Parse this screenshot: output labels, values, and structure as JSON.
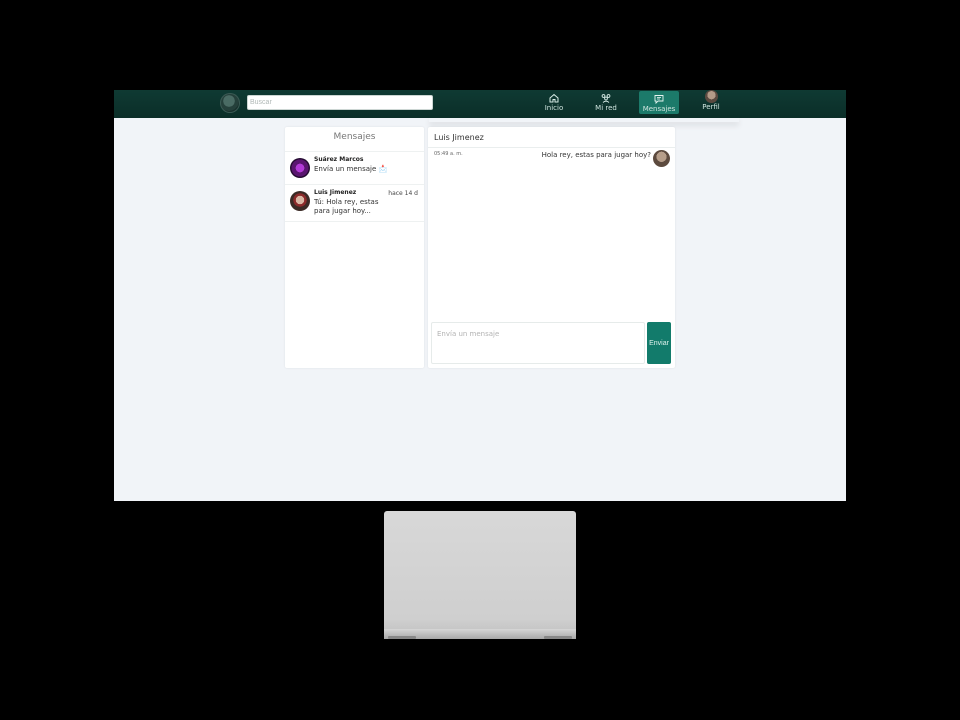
{
  "navbar": {
    "search_placeholder": "Buscar",
    "items": [
      {
        "label": "Inicio",
        "icon": "home-icon"
      },
      {
        "label": "Mi red",
        "icon": "people-icon"
      },
      {
        "label": "Mensajes",
        "icon": "message-icon",
        "active": true
      },
      {
        "label": "Perfil",
        "icon": "avatar"
      }
    ],
    "accent": "#0b2e28",
    "active_color": "#1c7a6a"
  },
  "messages_list": {
    "title": "Mensajes",
    "conversations": [
      {
        "name": "Suárez Marcos",
        "preview": "Envía un mensaje 📩",
        "time": ""
      },
      {
        "name": "Luis Jimenez",
        "preview": "Tú: Hola rey, estas para jugar hoy...",
        "time": "hace 14 d"
      }
    ]
  },
  "chat": {
    "contact_name": "Luis Jimenez",
    "messages": [
      {
        "time": "05:49 a. m.",
        "text": "Hola rey, estas para jugar hoy?"
      }
    ],
    "input_placeholder": "Envía un mensaje",
    "send_label": "Enviar",
    "send_color": "#127b6b"
  }
}
